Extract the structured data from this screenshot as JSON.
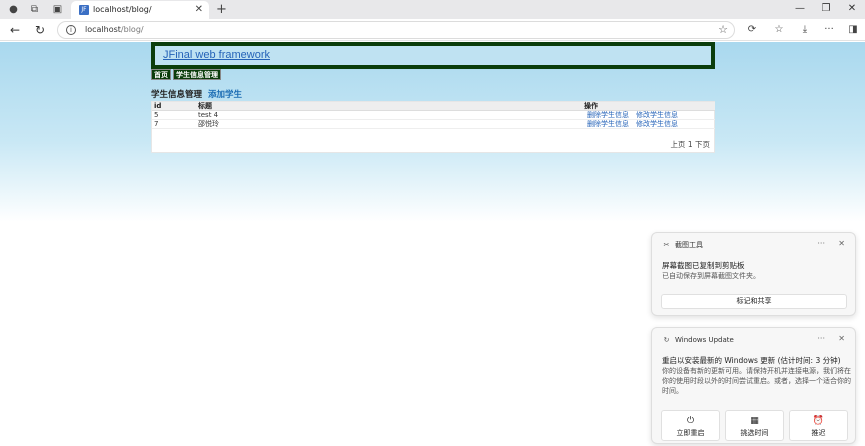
{
  "browser": {
    "tab_title": "localhost/blog/",
    "tab_favicon": "JF",
    "url_host": "localhost",
    "url_path": "/blog/",
    "icons": {
      "profile": "profile-icon",
      "collections": "collections-icon",
      "tab_actions": "tab-actions-icon",
      "new_tab": "plus-icon",
      "back": "back-arrow-icon",
      "refresh": "refresh-icon",
      "info": "info-icon",
      "favorite": "star-icon",
      "extensions": "extensions-icon",
      "favorites": "favorites-icon",
      "downloads": "downloads-icon",
      "more": "more-icon",
      "sidebar": "sidebar-icon"
    },
    "glyphs": {
      "profile": "●",
      "collections": "⧉",
      "tab_actions": "▣",
      "tab_close": "✕",
      "new_tab": "+",
      "minimize": "—",
      "maximize": "❐",
      "close": "✕",
      "back": "←",
      "refresh": "↻",
      "info": "i",
      "star": "☆",
      "extensions": "⟳",
      "favorites": "☆",
      "downloads": "⤓",
      "more": "···",
      "sidebar": "◨"
    }
  },
  "page": {
    "header_link": "JFinal web framework",
    "menu": [
      "首页",
      "学生信息管理"
    ],
    "section_title": "学生信息管理",
    "add_link": "添加学生",
    "table": {
      "columns": [
        "id",
        "标题",
        "操作"
      ],
      "rows": [
        {
          "id": "5",
          "title": "test 4",
          "delete": "删除学生信息",
          "edit": "修改学生信息"
        },
        {
          "id": "7",
          "title": "邵悦玲",
          "delete": "删除学生信息",
          "edit": "修改学生信息"
        }
      ]
    },
    "pager": {
      "prev": "上页",
      "current": "1",
      "next": "下页"
    }
  },
  "notifications": [
    {
      "app": "截图工具",
      "icon": "snipping-tool-icon",
      "title": "屏幕截图已复制到剪贴板",
      "body": "已自动保存到屏幕截图文件夹。",
      "button": "标记和共享",
      "more": "···",
      "close": "✕"
    },
    {
      "app": "Windows Update",
      "icon": "update-icon",
      "title": "重启以安装最新的 Windows 更新 (估计时间: 3 分钟)",
      "body": "你的设备有新的更新可用。请保持开机并连接电源，我们将在你的使用时段以外的时间尝试重启。或者，选择一个适合你的时间。",
      "buttons": [
        "立即重启",
        "挑选时间",
        "推迟"
      ],
      "button_icons": [
        "power-icon",
        "calendar-icon",
        "alarm-icon"
      ],
      "more": "···",
      "close": "✕"
    }
  ]
}
